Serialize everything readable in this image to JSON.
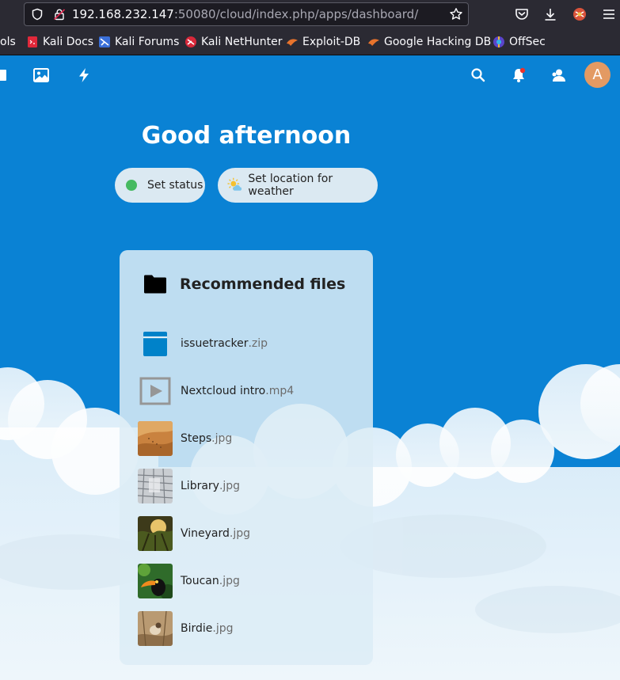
{
  "browser": {
    "url_host": "192.168.232.147",
    "url_rest": ":50080/cloud/index.php/apps/dashboard/",
    "bookmarks": [
      {
        "label": "ols",
        "icon": "none"
      },
      {
        "label": "Kali Docs",
        "icon": "kali-docs-icon"
      },
      {
        "label": "Kali Forums",
        "icon": "kali-forums-icon"
      },
      {
        "label": "Kali NetHunter",
        "icon": "kali-nethunter-icon"
      },
      {
        "label": "Exploit-DB",
        "icon": "exploit-db-icon"
      },
      {
        "label": "Google Hacking DB",
        "icon": "ghdb-icon"
      },
      {
        "label": "OffSec",
        "icon": "offsec-icon"
      }
    ]
  },
  "header": {
    "avatar_initial": "A"
  },
  "dashboard": {
    "greeting": "Good afternoon",
    "status_label": "Set status",
    "weather_label": "Set location for weather"
  },
  "recommended": {
    "title": "Recommended files",
    "files": [
      {
        "name": "issuetracker",
        "ext": ".zip",
        "icon": "archive-icon"
      },
      {
        "name": "Nextcloud intro",
        "ext": ".mp4",
        "icon": "video-icon"
      },
      {
        "name": "Steps",
        "ext": ".jpg",
        "icon": "image-thumbnail"
      },
      {
        "name": "Library",
        "ext": ".jpg",
        "icon": "image-thumbnail"
      },
      {
        "name": "Vineyard",
        "ext": ".jpg",
        "icon": "image-thumbnail"
      },
      {
        "name": "Toucan",
        "ext": ".jpg",
        "icon": "image-thumbnail"
      },
      {
        "name": "Birdie",
        "ext": ".jpg",
        "icon": "image-thumbnail"
      }
    ]
  },
  "colors": {
    "page_background": "#0a82d4",
    "avatar": "#e39a63",
    "status_online": "#46ba61"
  }
}
